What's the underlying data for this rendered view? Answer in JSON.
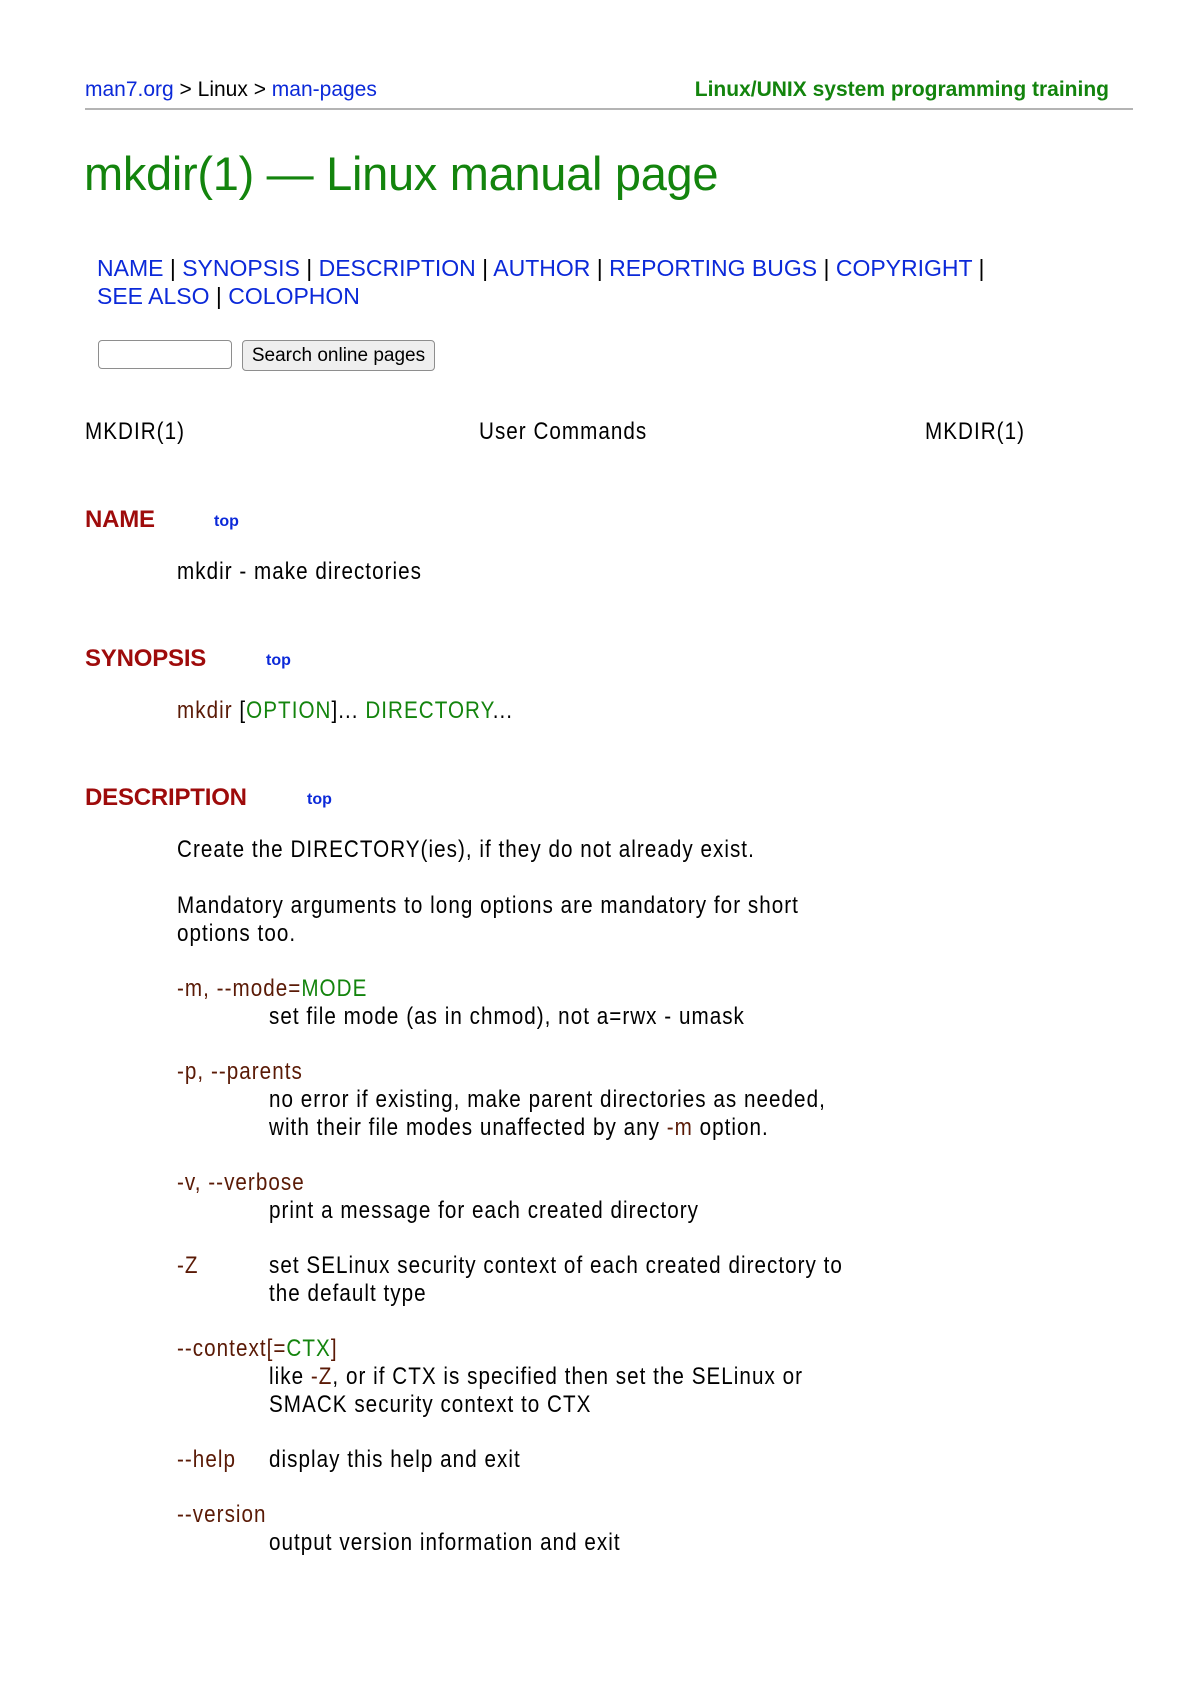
{
  "breadcrumb": {
    "site": "man7.org",
    "sep1": " > ",
    "section": "Linux",
    "sep2": " > ",
    "pages": "man-pages"
  },
  "training_link": "Linux/UNIX system programming training",
  "title": "mkdir(1) — Linux manual page",
  "toc": [
    "NAME",
    "SYNOPSIS",
    "DESCRIPTION",
    "AUTHOR",
    "REPORTING BUGS",
    "COPYRIGHT",
    "SEE ALSO",
    "COLOPHON"
  ],
  "toc_separator": "|",
  "search": {
    "value": "",
    "placeholder": "",
    "button_label": "Search online pages"
  },
  "man_header": {
    "left": "MKDIR(1)",
    "center": "User Commands",
    "right": "MKDIR(1)"
  },
  "top_label": "top",
  "sections": {
    "name": {
      "heading": "NAME",
      "text": "mkdir - make directories"
    },
    "synopsis": {
      "heading": "SYNOPSIS",
      "command": "mkdir",
      "open_bracket": " [",
      "option": "OPTION",
      "close": "]... ",
      "directory": "DIRECTORY",
      "ellipsis": "..."
    },
    "description": {
      "heading": "DESCRIPTION",
      "intro": "Create the DIRECTORY(ies), if they do not already exist.",
      "mandatory_line1": "Mandatory arguments to long options are mandatory for short",
      "mandatory_line2": "options too.",
      "options": {
        "mode": {
          "flag": "-m, --mode=",
          "arg": "MODE",
          "desc": "set file mode (as in chmod), not a=rwx - umask"
        },
        "parents": {
          "flag": "-p, --parents",
          "desc1": "no error if existing, make parent directories as needed,",
          "desc2_pre": "with their file modes unaffected by any ",
          "desc2_flag": "-m",
          "desc2_post": " option."
        },
        "verbose": {
          "flag": "-v, --verbose",
          "desc": "print a message for each created directory"
        },
        "z": {
          "flag": "-Z",
          "desc1": "set SELinux security context of each created directory to",
          "desc2": "the default type"
        },
        "context": {
          "flag": "--context[=",
          "arg": "CTX",
          "close": "]",
          "desc1_pre": "like ",
          "desc1_flag": "-Z",
          "desc1_post": ", or if CTX is specified then set the SELinux or",
          "desc2": "SMACK security context to CTX"
        },
        "help": {
          "flag": "--help",
          "desc": "display this help and exit"
        },
        "version": {
          "flag": "--version",
          "desc": "output version information and exit"
        }
      }
    }
  }
}
